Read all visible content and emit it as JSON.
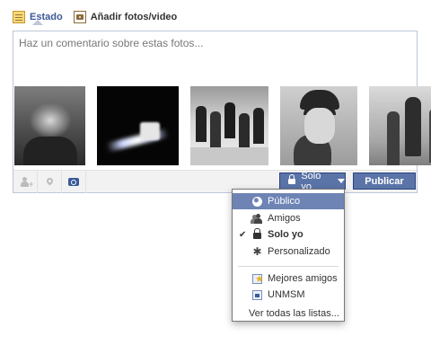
{
  "tabs": [
    {
      "label": "Estado",
      "icon": "notepad-icon"
    },
    {
      "label": "Añadir fotos/video",
      "icon": "photo-icon"
    }
  ],
  "composer": {
    "placeholder": "Haz un comentario sobre estas fotos...",
    "photos_count_visible": 5,
    "toolbar": {
      "tag_icon": "add-person-icon",
      "location_icon": "location-pin-icon",
      "camera_icon": "camera-icon"
    },
    "privacy_label": "Solo yo",
    "publish_label": "Publicar"
  },
  "privacy_menu": {
    "items": [
      {
        "label": "Público",
        "icon": "globe-icon",
        "highlighted": true,
        "checked": false
      },
      {
        "label": "Amigos",
        "icon": "friends-icon",
        "highlighted": false,
        "checked": false
      },
      {
        "label": "Solo yo",
        "icon": "lock-icon",
        "highlighted": false,
        "checked": true
      },
      {
        "label": "Personalizado",
        "icon": "gear-icon",
        "highlighted": false,
        "checked": false
      }
    ],
    "lists": [
      {
        "label": "Mejores amigos",
        "icon": "star-list-icon"
      },
      {
        "label": "UNMSM",
        "icon": "list-icon"
      }
    ],
    "see_all_label": "Ver todas las listas...",
    "check_mark": "✔"
  },
  "colors": {
    "brand": "#3b5998",
    "button": "#5b74a8",
    "highlight": "#6d84b4",
    "border": "#bdc7d8"
  }
}
